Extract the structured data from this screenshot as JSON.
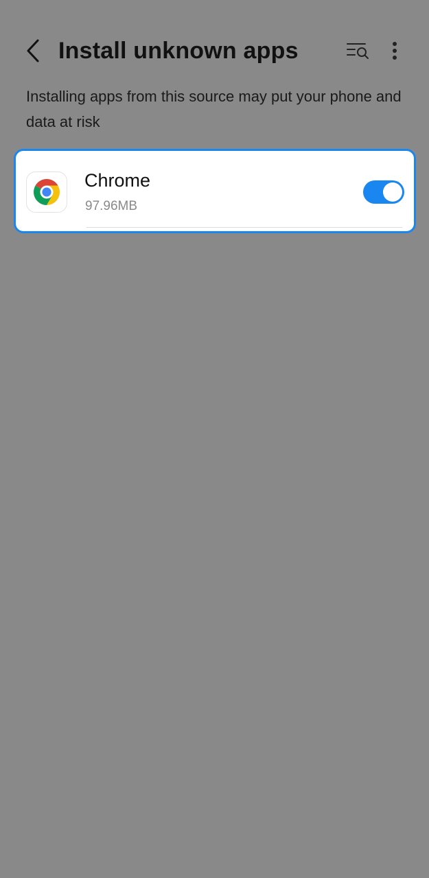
{
  "header": {
    "title": "Install unknown apps",
    "back_icon": "chevron-left-icon",
    "search_icon": "list-search-icon",
    "more_icon": "more-vertical-icon"
  },
  "warning": {
    "text": "Installing apps from this source may put your phone and data at risk"
  },
  "app": {
    "name": "Chrome",
    "size": "97.96MB",
    "icon": "chrome-logo-icon",
    "toggle_on": true
  },
  "colors": {
    "background": "#898989",
    "accent": "#1a86f0",
    "card": "#ffffff"
  }
}
